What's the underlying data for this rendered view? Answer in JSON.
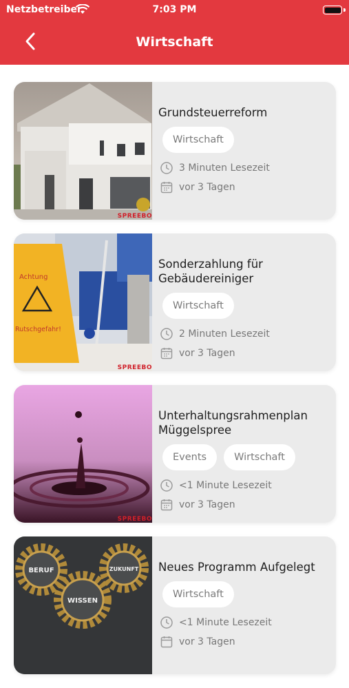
{
  "status_bar": {
    "carrier": "Netzbetreiber",
    "time": "7:03 PM"
  },
  "header": {
    "title": "Wirtschaft",
    "back_icon": "chevron-left-icon"
  },
  "colors": {
    "accent": "#e3393f",
    "card_bg": "#ebebeb",
    "tag_bg": "#ffffff",
    "meta_text": "#777777"
  },
  "articles": [
    {
      "headline": "Grundsteuerreform",
      "tags": [
        "Wirtschaft"
      ],
      "read_time": "3 Minuten Lesezeit",
      "date": "vor 3 Tagen",
      "watermark": "SPREEBO"
    },
    {
      "headline": "Sonderzahlung für Gebäudereiniger",
      "tags": [
        "Wirtschaft"
      ],
      "read_time": "2 Minuten Lesezeit",
      "date": "vor 3 Tagen",
      "watermark": "SPREEBO",
      "sign_top": "Achtung",
      "sign_bottom": "Rutschgefahr!"
    },
    {
      "headline": "Unterhaltungsrahmenplan Müggelspree",
      "tags": [
        "Events",
        "Wirtschaft"
      ],
      "read_time": "<1 Minute Lesezeit",
      "date": "vor 3 Tagen",
      "watermark": "SPREEBO"
    },
    {
      "headline": "Neues Programm Aufgelegt",
      "tags": [
        "Wirtschaft"
      ],
      "read_time": "<1 Minute Lesezeit",
      "date": "vor 3 Tagen",
      "gear_words": [
        "BERUF",
        "ZUKUNFT",
        "WISSEN"
      ]
    }
  ]
}
